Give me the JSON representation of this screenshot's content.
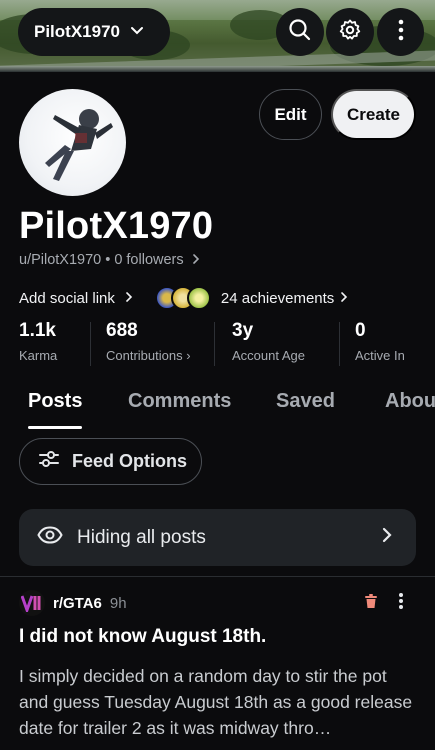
{
  "header": {
    "username": "PilotX1970"
  },
  "profile": {
    "display_name": "PilotX1970",
    "handle": "u/PilotX1970",
    "followers": "0 followers",
    "edit_label": "Edit",
    "create_label": "Create",
    "social_link_label": "Add social link",
    "achievements_label": "24 achievements",
    "badge_colors": [
      "#3a56c5",
      "#d6b43b",
      "#9cc247"
    ]
  },
  "stats": [
    {
      "value": "1.1k",
      "label": "Karma"
    },
    {
      "value": "688",
      "label": "Contributions ›"
    },
    {
      "value": "3y",
      "label": "Account Age"
    },
    {
      "value": "0",
      "label": "Active In"
    }
  ],
  "tabs": [
    "Posts",
    "Comments",
    "Saved",
    "About"
  ],
  "feed_options_label": "Feed Options",
  "hiding_label": "Hiding all posts",
  "post": {
    "subreddit": "r/GTA6",
    "age": "9h",
    "title": "I did not know August 18th.",
    "body": "I simply decided on a random day to stir the pot and guess Tuesday August 18th as a good release date for trailer 2 as it was midway thro…"
  },
  "colors": {
    "background": "#0b0b0d",
    "trash": "#f08a7a",
    "subreddit_icon": "#b540c9"
  }
}
